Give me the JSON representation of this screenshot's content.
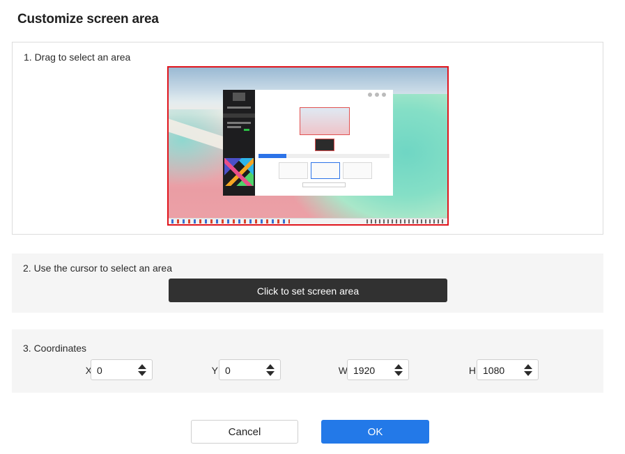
{
  "dialog": {
    "title": "Customize screen area"
  },
  "step1": {
    "label": "1. Drag to select an area",
    "selection_color": "#e0141c"
  },
  "step2": {
    "label": "2. Use the cursor to select an area",
    "button_label": "Click to set screen area"
  },
  "step3": {
    "label": "3. Coordinates",
    "fields": [
      {
        "label": "X",
        "value": "0"
      },
      {
        "label": "Y",
        "value": "0"
      },
      {
        "label": "W",
        "value": "1920"
      },
      {
        "label": "H",
        "value": "1080"
      }
    ]
  },
  "footer": {
    "cancel_label": "Cancel",
    "ok_label": "OK",
    "ok_color": "#2379e8"
  }
}
